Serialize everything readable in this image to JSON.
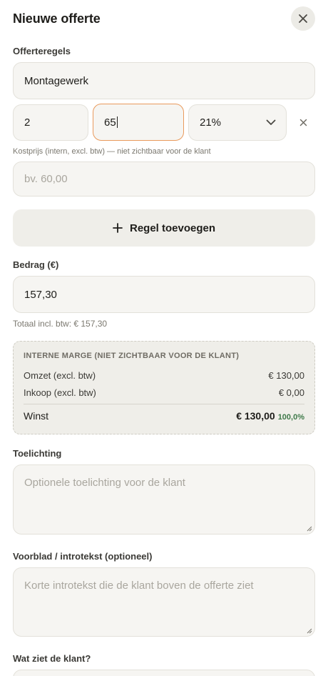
{
  "header": {
    "title": "Nieuwe offerte"
  },
  "lines": {
    "section_label": "Offerteregels",
    "description": "Montagewerk",
    "quantity": "2",
    "price": "65",
    "vat": "21%",
    "cost_hint": "Kostprijs (intern, excl. btw) — niet zichtbaar voor de klant",
    "cost_placeholder": "bv. 60,00"
  },
  "add_line_label": "Regel toevoegen",
  "amount": {
    "label": "Bedrag (€)",
    "value": "157,30",
    "total_hint": "Totaal incl. btw: € 157,30"
  },
  "margin": {
    "title": "INTERNE MARGE (NIET ZICHTBAAR VOOR DE KLANT)",
    "revenue_label": "Omzet (excl. btw)",
    "revenue_value": "€ 130,00",
    "purchase_label": "Inkoop (excl. btw)",
    "purchase_value": "€ 0,00",
    "profit_label": "Winst",
    "profit_value": "€ 130,00",
    "profit_pct": "100,0%"
  },
  "explanation": {
    "label": "Toelichting",
    "placeholder": "Optionele toelichting voor de klant"
  },
  "cover": {
    "label": "Voorblad / introtekst (optioneel)",
    "placeholder": "Korte introtekst die de klant boven de offerte ziet"
  },
  "visibility": {
    "label": "Wat ziet de klant?"
  },
  "colors": {
    "focus_border": "#e99a5c",
    "profit_pct": "#3f7a4a"
  }
}
